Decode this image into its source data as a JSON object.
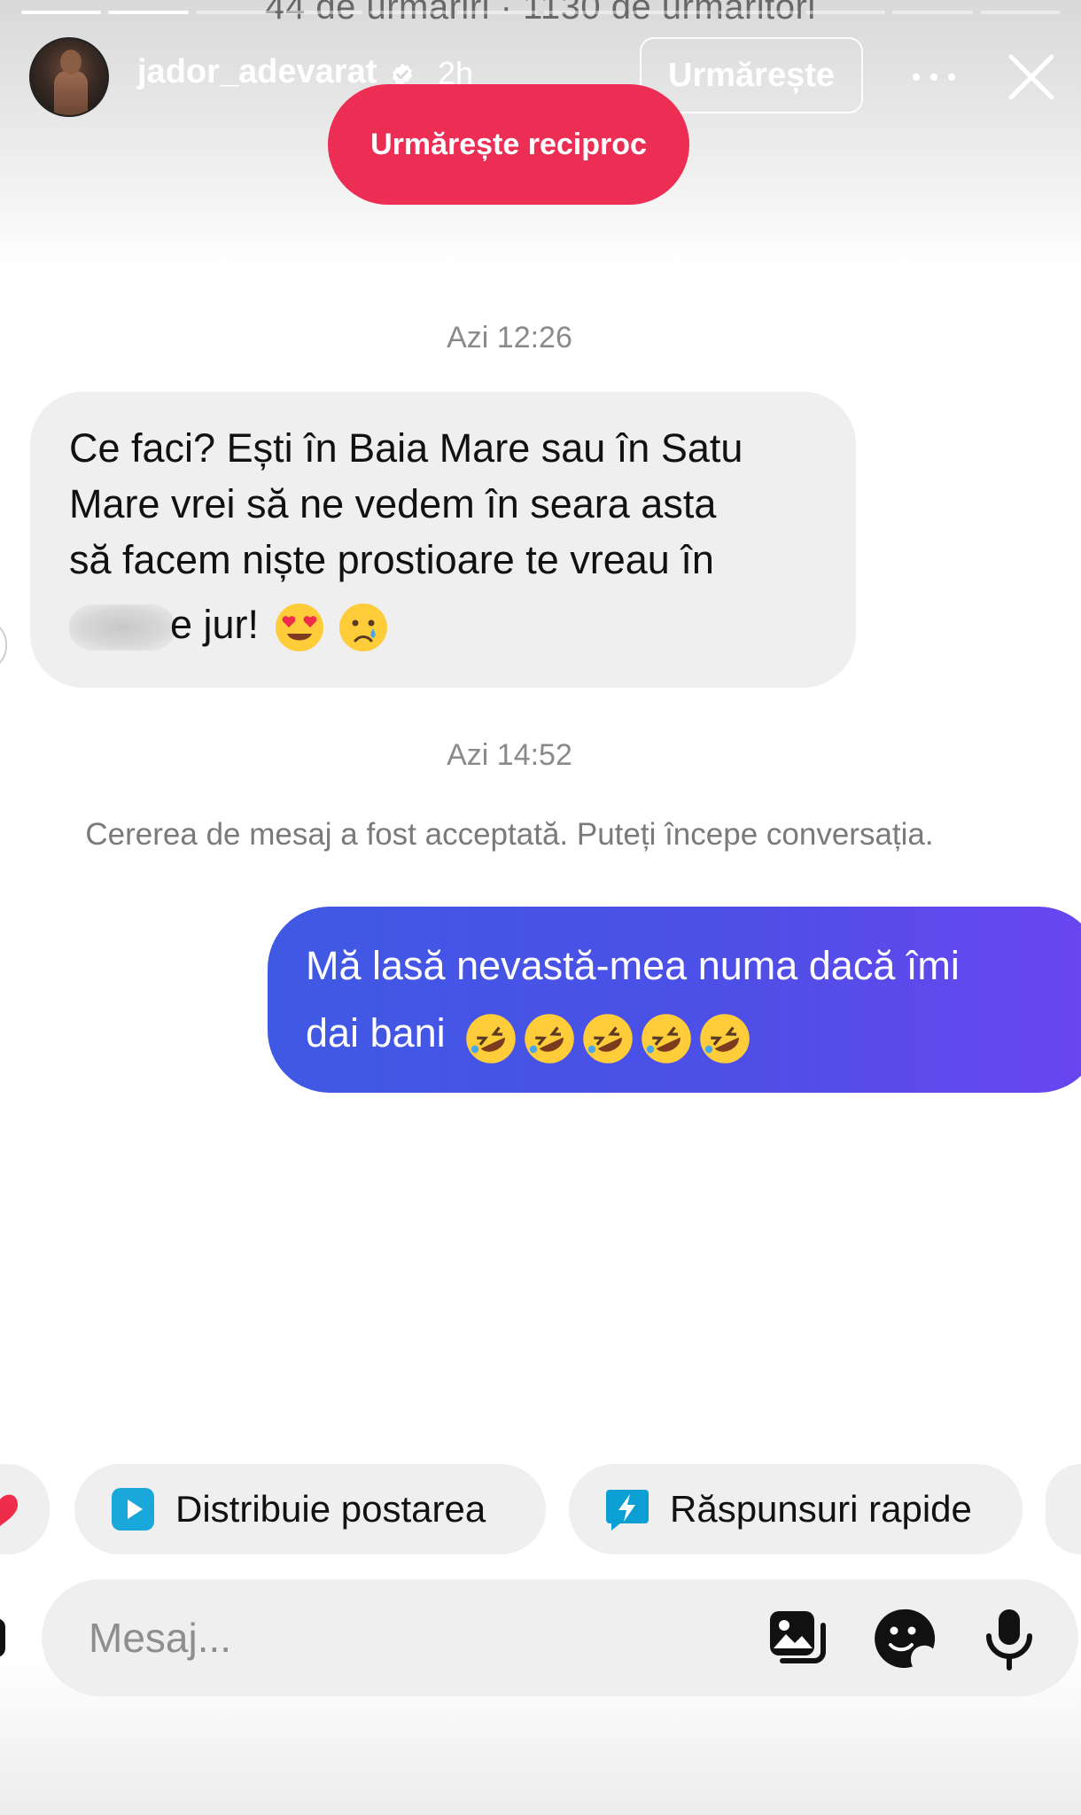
{
  "story": {
    "behind_text": "44 de urmăriri · 1130 de urmăritori",
    "username": "jador_adevarat",
    "time_ago": "2h",
    "follow_label": "Urmărește",
    "follow_back_label": "Urmărește reciproc"
  },
  "conversation": {
    "timestamp_1": "Azi 12:26",
    "incoming": {
      "line1": "Ce faci? Ești în Baia Mare sau în Satu",
      "line2": "Mare vrei să ne vedem în seara asta",
      "line3": "să facem niște prostioare te vreau în",
      "line4_tail": "e jur!"
    },
    "timestamp_2": "Azi 14:52",
    "system_note": "Cererea de mesaj a fost acceptată. Puteți începe conversația.",
    "outgoing": {
      "line1": "Mă lasă nevastă-mea numa dacă îmi",
      "line2": "dai bani"
    }
  },
  "quick_actions": {
    "share_label": "Distribuie postarea",
    "quick_replies_label": "Răspunsuri rapide"
  },
  "composer": {
    "placeholder": "Mesaj..."
  },
  "icons": {
    "verified": "verified-badge-icon",
    "more": "more-horizontal-icon",
    "close": "close-icon",
    "share": "play-square-icon",
    "quick_replies": "lightning-bubble-icon",
    "gallery": "gallery-icon",
    "sticker": "sticker-icon",
    "mic": "microphone-icon",
    "heart": "heart-icon"
  },
  "colors": {
    "follow_back": "#ec2d54",
    "outgoing_bubble_start": "#3f59e4",
    "outgoing_bubble_end": "#6a45f0",
    "incoming_bubble": "#efefef",
    "share_icon": "#1aa7d9",
    "quick_reply_icon": "#0c9fd4"
  }
}
